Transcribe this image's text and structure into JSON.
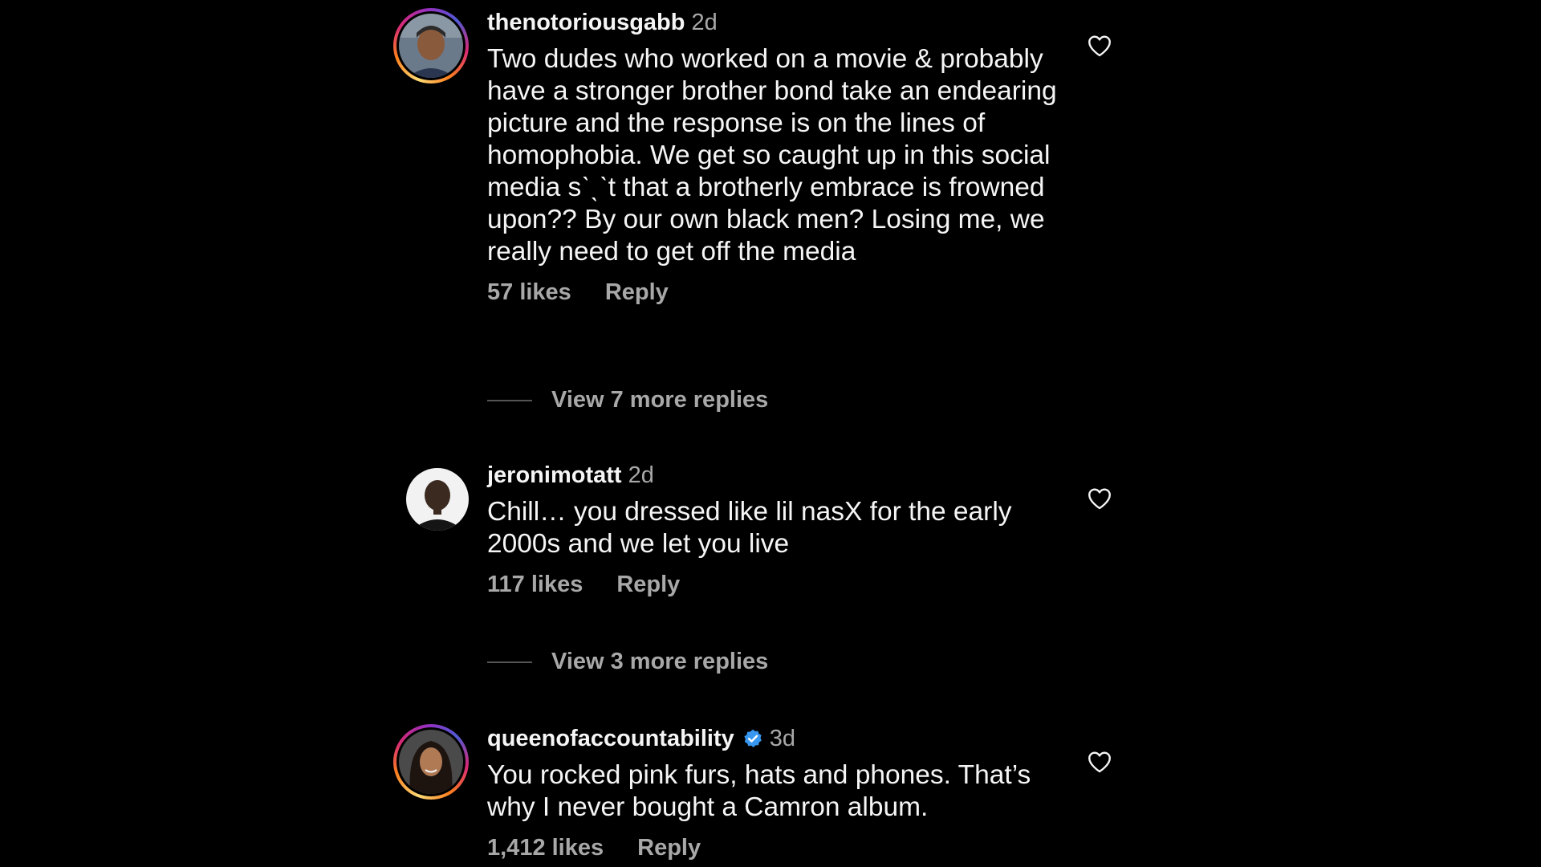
{
  "comments": [
    {
      "username": "thenotoriousgabb",
      "time": "2d",
      "text": "Two dudes who worked on a movie & probably have a stronger brother bond take an endearing picture and the response is on the lines of homophobia. We get so caught up in this social media sˋˎˋt that a brotherly embrace is frowned upon?? By our own black men? Losing me, we really need to get off the media",
      "likes": "57 likes",
      "reply": "Reply",
      "view_replies": "View 7 more replies",
      "avatar_icon": "user-avatar-story-ring"
    },
    {
      "username": "jeronimotatt",
      "time": "2d",
      "text": "Chill… you dressed like lil nasX for the early 2000s and we let you live",
      "likes": "117 likes",
      "reply": "Reply",
      "view_replies": "View 3 more replies",
      "avatar_icon": "user-avatar"
    },
    {
      "username": "queenofaccountability",
      "time": "3d",
      "verified": true,
      "text": "You rocked pink furs, hats and phones. That’s why I never bought a Camron album.",
      "likes": "1,412 likes",
      "reply": "Reply",
      "avatar_icon": "user-avatar-story-ring"
    }
  ],
  "colors": {
    "background": "#000000",
    "primary_text": "#f5f5f5",
    "secondary_text": "#a8a8a8",
    "verified_blue": "#3897f0"
  },
  "icons": [
    "heart-outline-icon",
    "verified-badge-icon"
  ]
}
